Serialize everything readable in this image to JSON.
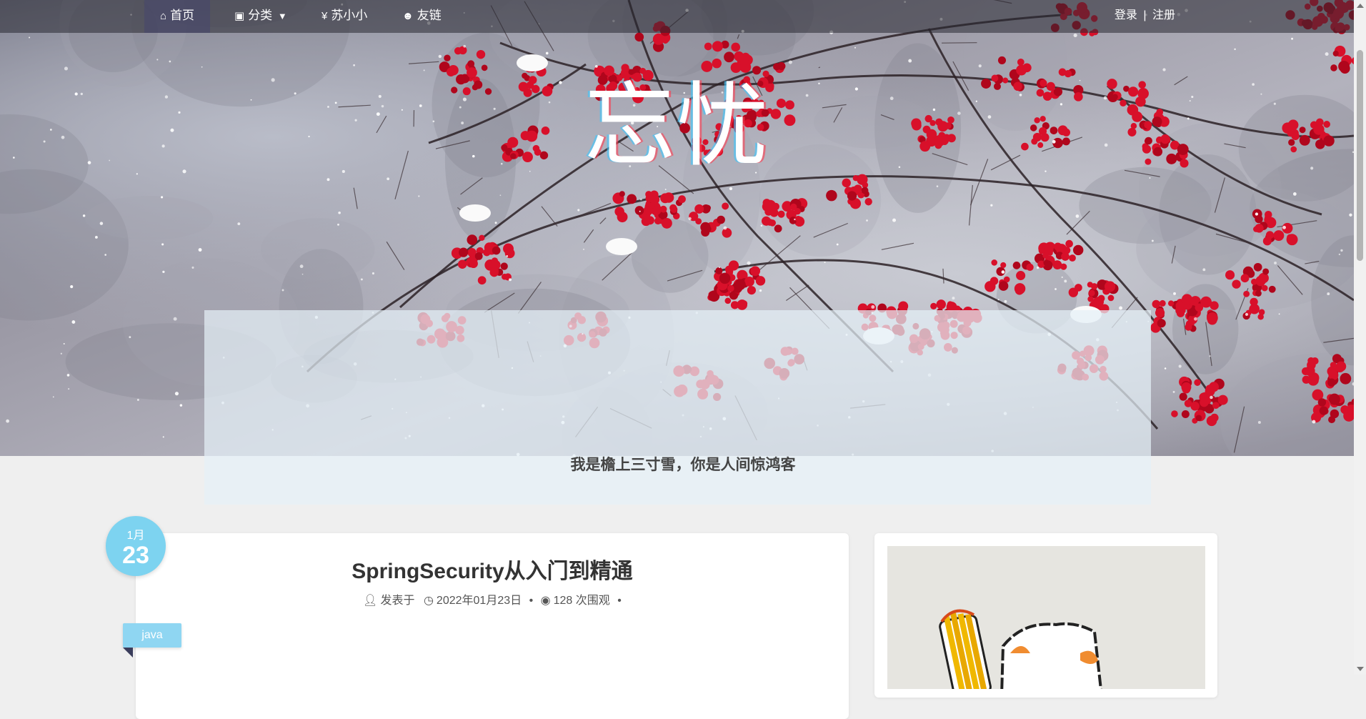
{
  "nav": {
    "items": [
      {
        "label": "首页",
        "icon": "home-icon"
      },
      {
        "label": "分类",
        "icon": "archive-icon",
        "caret": "caret-down-icon"
      },
      {
        "label": "苏小小",
        "icon": "yen-icon"
      },
      {
        "label": "友链",
        "icon": "users-icon"
      }
    ],
    "login": "登录",
    "separator": "|",
    "register": "注册"
  },
  "hero": {
    "title": "忘忧",
    "quote": "我是檐上三寸雪，你是人间惊鸿客"
  },
  "post": {
    "date_month": "1月",
    "date_day": "23",
    "title": "SpringSecurity从入门到精通",
    "meta_author": "发表于",
    "meta_date": "2022年01月23日",
    "meta_sep": "•",
    "meta_views": "128 次围观",
    "tag": "java"
  },
  "colors": {
    "accent": "#7dd3f0",
    "berry_red": "#d8102a",
    "navbar": "rgba(40,40,50,0.55)"
  }
}
